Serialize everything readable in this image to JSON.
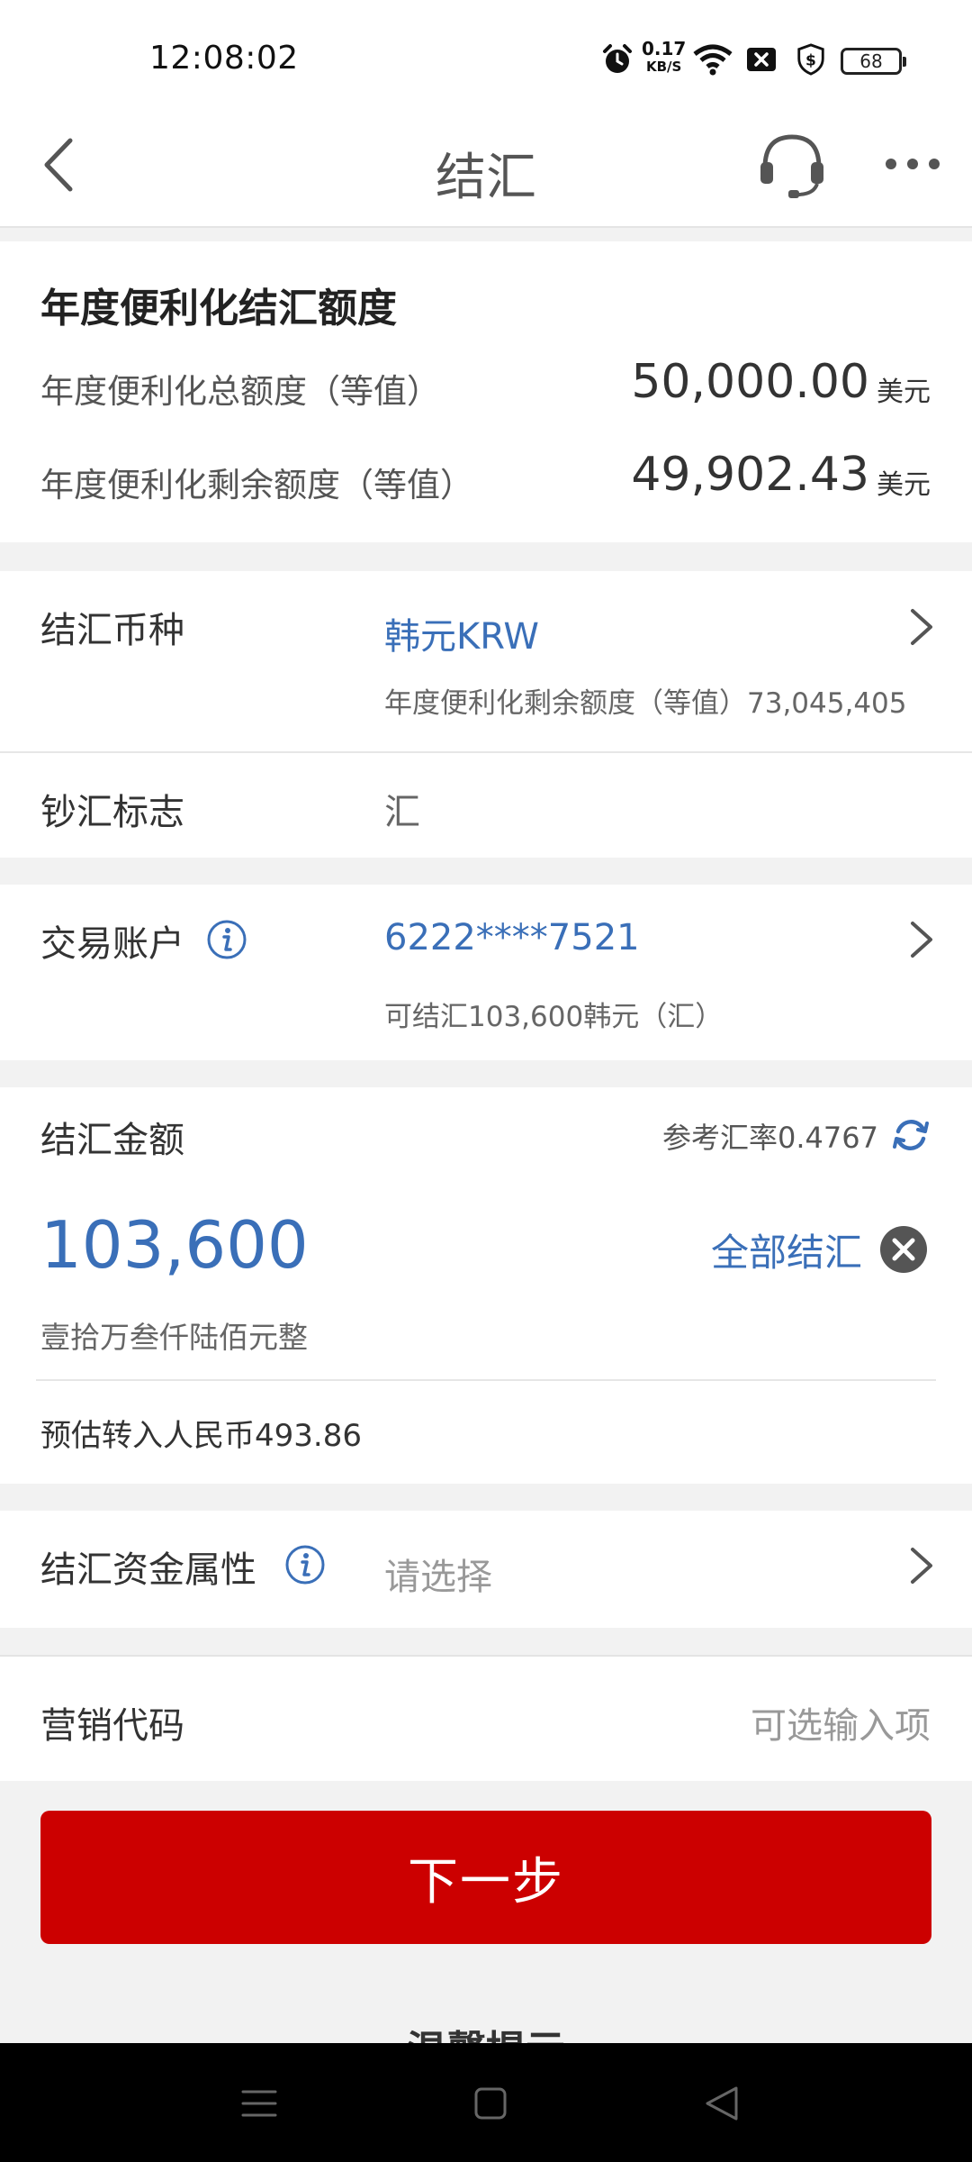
{
  "status_bar": {
    "time": "12:08:02",
    "net_speed_value": "0.17",
    "net_speed_unit": "KB/S",
    "battery": "68",
    "icons": [
      "alarm-icon",
      "wifi-icon",
      "close-box-icon",
      "shield-dollar-icon",
      "battery-icon"
    ]
  },
  "nav": {
    "title": "结汇",
    "back_icon": "chevron-left-icon",
    "support_icon": "headset-icon",
    "more_icon": "more-dots-icon"
  },
  "quota": {
    "title": "年度便利化结汇额度",
    "total_label": "年度便利化总额度（等值）",
    "total_amount": "50,000.00",
    "total_unit": "美元",
    "remaining_label": "年度便利化剩余额度（等值）",
    "remaining_amount": "49,902.43",
    "remaining_unit": "美元"
  },
  "currency": {
    "label": "结汇币种",
    "value": "韩元KRW",
    "sub": "年度便利化剩余额度（等值）73,045,405"
  },
  "cash_flag": {
    "label": "钞汇标志",
    "value": "汇"
  },
  "account": {
    "label": "交易账户",
    "value": "6222****7521",
    "sub": "可结汇103,600韩元（汇）"
  },
  "amount": {
    "label": "结汇金额",
    "rate": "参考汇率0.4767",
    "value": "103,600",
    "all_button": "全部结汇",
    "chinese": "壹拾万叁仟陆佰元整",
    "estimate": "预估转入人民币493.86"
  },
  "fund_attr": {
    "label": "结汇资金属性",
    "placeholder": "请选择"
  },
  "marketing": {
    "label": "营销代码",
    "placeholder": "可选输入项"
  },
  "next_button": "下一步",
  "tips_title": "温馨提示",
  "colors": {
    "accent_blue": "#3a6fb8",
    "primary_red": "#cc0000",
    "background": "#f2f2f2"
  }
}
